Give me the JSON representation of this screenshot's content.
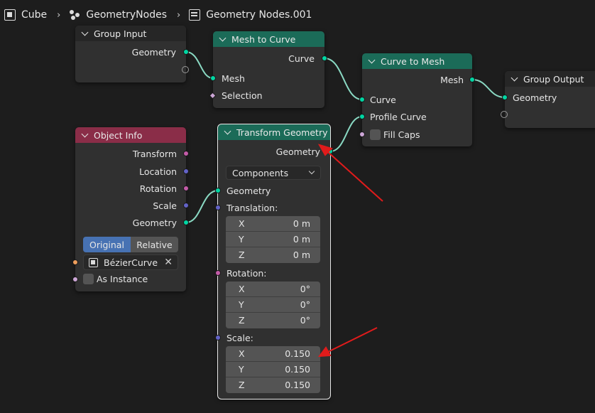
{
  "breadcrumb": {
    "object": "Cube",
    "modifier": "GeometryNodes",
    "node_tree": "Geometry Nodes.001"
  },
  "icons": {
    "object": "cube-object-icon",
    "modifier": "geometry-nodes-icon",
    "node_tree": "node-tree-icon"
  },
  "colors": {
    "geometry_header": "#1b6b58",
    "input_header": "#8a2d48",
    "geometry_socket": "#00d6a3",
    "annotation_arrow": "#e01b1b",
    "active_toggle": "#4772b3"
  },
  "nodes": {
    "group_input": {
      "title": "Group Input",
      "outputs": [
        "Geometry"
      ]
    },
    "mesh_to_curve": {
      "title": "Mesh to Curve",
      "outputs": [
        "Curve"
      ],
      "inputs": [
        "Mesh",
        "Selection"
      ]
    },
    "curve_to_mesh": {
      "title": "Curve to Mesh",
      "outputs": [
        "Mesh"
      ],
      "inputs": [
        "Curve",
        "Profile Curve",
        "Fill Caps"
      ]
    },
    "group_output": {
      "title": "Group Output",
      "inputs": [
        "Geometry"
      ]
    },
    "object_info": {
      "title": "Object Info",
      "outputs": [
        "Transform",
        "Location",
        "Rotation",
        "Scale",
        "Geometry"
      ],
      "toggle": [
        "Original",
        "Relative"
      ],
      "object_value": "BézierCurve",
      "as_instance": "As Instance"
    },
    "transform_geometry": {
      "title": "Transform Geometry",
      "output": "Geometry",
      "mode": "Components",
      "input_geometry": "Geometry",
      "translation": {
        "label": "Translation:",
        "x": "0 m",
        "y": "0 m",
        "z": "0 m"
      },
      "rotation": {
        "label": "Rotation:",
        "x": "0°",
        "y": "0°",
        "z": "0°"
      },
      "scale": {
        "label": "Scale:",
        "x": "0.150",
        "y": "0.150",
        "z": "0.150"
      },
      "axis": [
        "X",
        "Y",
        "Z"
      ]
    }
  }
}
